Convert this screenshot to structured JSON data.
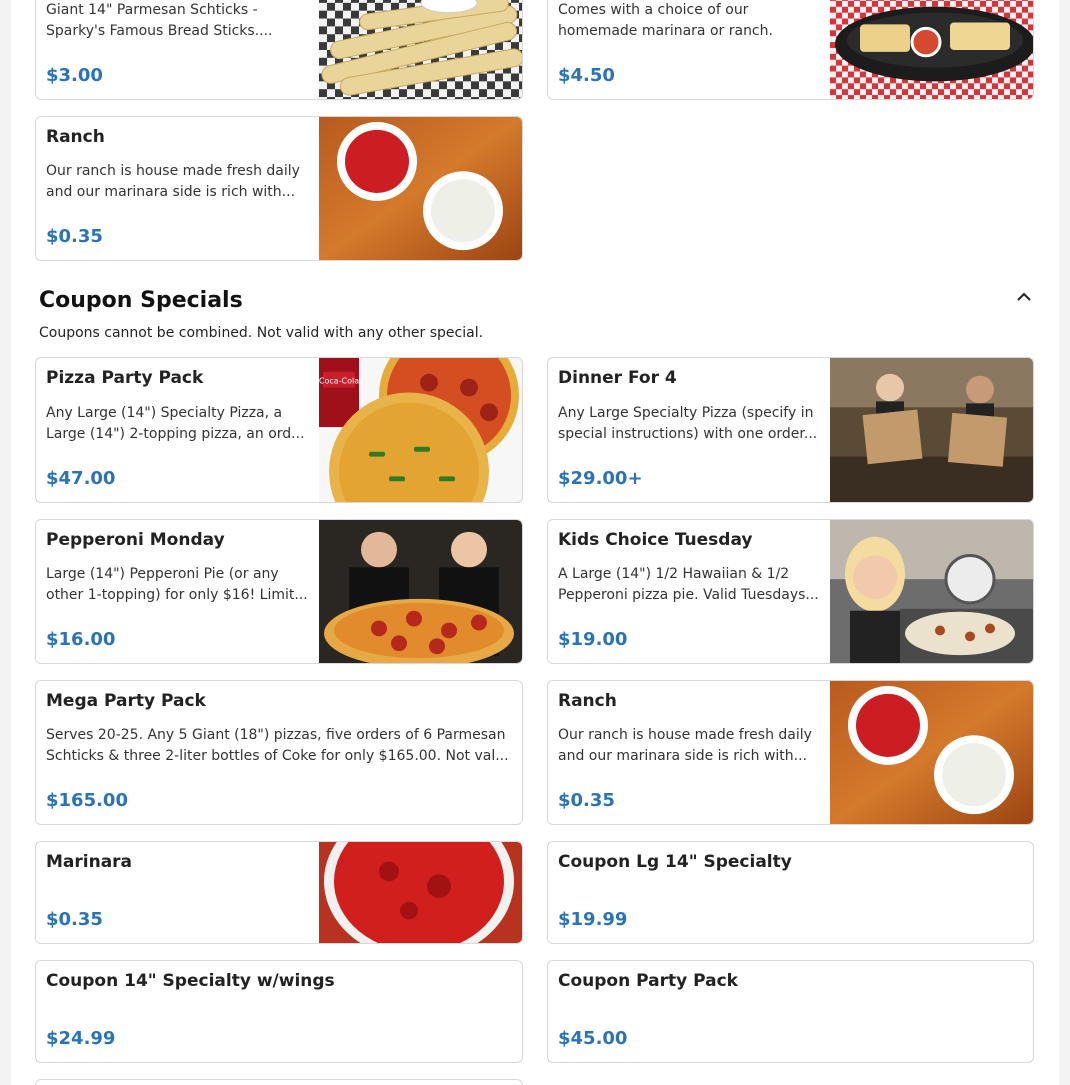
{
  "top_items": [
    {
      "title": "",
      "description": "Giant 14\" Parmesan Schticks - Sparky's Famous Bread Sticks....",
      "price": "$3.00",
      "image": "breadsticks-photo"
    },
    {
      "title": "",
      "description": "Comes with a choice of our homemade marinara or ranch.",
      "price": "$4.50",
      "image": "cheesy-bread-basket-photo"
    },
    {
      "title": "Ranch",
      "description": "Our ranch is house made fresh daily and our marinara side is rich with...",
      "price": "$0.35",
      "image": "ranch-marinara-cups-photo"
    }
  ],
  "section": {
    "title": "Coupon Specials",
    "subtitle": "Coupons cannot be combined. Not valid with any other special."
  },
  "coupon_items": [
    {
      "title": "Pizza Party Pack",
      "description": "Any Large (14\") Specialty Pizza, a Large (14\") 2-topping pizza, an ord...",
      "price": "$47.00",
      "image": "pizzas-coke-photo"
    },
    {
      "title": "Dinner For 4",
      "description": "Any Large Specialty Pizza (specify in special instructions) with one order...",
      "price": "$29.00+",
      "image": "staff-pizza-boxes-photo"
    },
    {
      "title": "Pepperoni Monday",
      "description": "Large (14\") Pepperoni Pie (or any other 1-topping) for only $16! Limit...",
      "price": "$16.00",
      "image": "staff-pepperoni-pizza-photo"
    },
    {
      "title": "Kids Choice Tuesday",
      "description": "A Large (14\") 1/2 Hawaiian & 1/2 Pepperoni pizza pie. Valid Tuesdays...",
      "price": "$19.00",
      "image": "kid-making-pizza-photo"
    },
    {
      "title": "Mega Party Pack",
      "description": "Serves 20-25. Any 5 Giant (18\") pizzas, five orders of 6 Parmesan Schticks & three 2-liter bottles of Coke for only $165.00. Not val...",
      "price": "$165.00",
      "image": ""
    },
    {
      "title": "Ranch",
      "description": "Our ranch is house made fresh daily and our marinara side is rich with...",
      "price": "$0.35",
      "image": "ranch-marinara-cups-photo"
    },
    {
      "title": "Marinara",
      "description": "",
      "price": "$0.35",
      "image": "marinara-bowl-photo"
    },
    {
      "title": "Coupon Lg 14\" Specialty",
      "description": "",
      "price": "$19.99",
      "image": ""
    },
    {
      "title": "Coupon 14\" Specialty w/wings",
      "description": "",
      "price": "$24.99",
      "image": ""
    },
    {
      "title": "Coupon Party Pack",
      "description": "",
      "price": "$45.00",
      "image": ""
    }
  ],
  "colors": {
    "price": "#2a73b8",
    "border": "#d7d7d7"
  }
}
